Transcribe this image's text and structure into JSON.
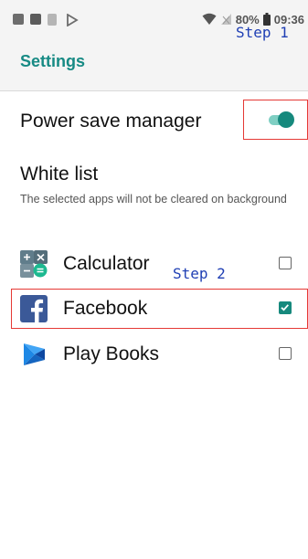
{
  "status_bar": {
    "battery_percent": "80%",
    "time": "09:36",
    "icons": [
      "notification-icon",
      "photo-icon",
      "download-icon",
      "play-store-icon",
      "wifi-icon",
      "no-signal-icon",
      "battery-icon"
    ]
  },
  "header": {
    "title": "Settings"
  },
  "annotations": {
    "step1": "Step 1",
    "step2": "Step 2"
  },
  "power_save": {
    "label": "Power save manager",
    "enabled": true
  },
  "white_list": {
    "title": "White list",
    "description": "The selected apps will not be cleared on background",
    "apps": [
      {
        "name": "Calculator",
        "icon": "calculator-icon",
        "checked": false
      },
      {
        "name": "Facebook",
        "icon": "facebook-icon",
        "checked": true
      },
      {
        "name": "Play Books",
        "icon": "play-books-icon",
        "checked": false
      }
    ]
  },
  "colors": {
    "accent": "#16897d",
    "annotation_blue": "#1f3fb4",
    "highlight_red": "#e53935",
    "facebook_blue": "#3b5998"
  }
}
